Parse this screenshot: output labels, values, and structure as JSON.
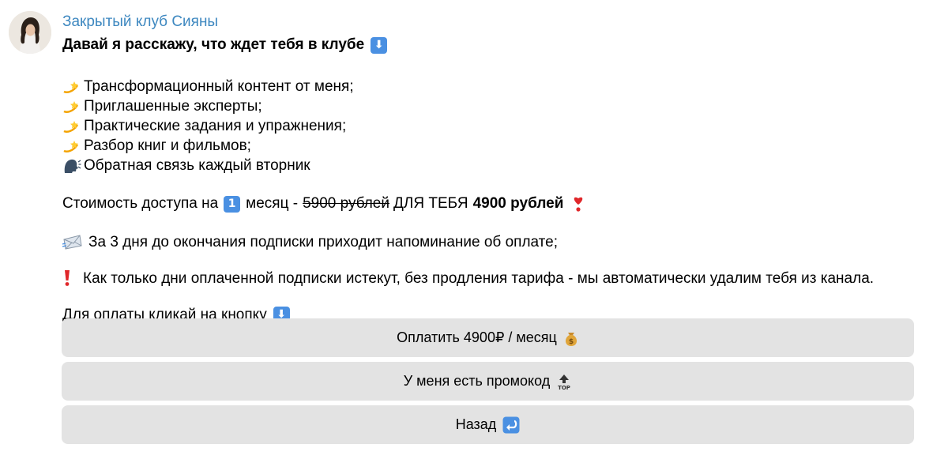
{
  "channel": {
    "name": "Закрытый клуб Сияны"
  },
  "message": {
    "headline": "Давай я расскажу, что ждет тебя в клубе",
    "features": [
      "Трансформационный контент от меня;",
      "Приглашенные эксперты;",
      "Практические задания и упражнения;",
      "Разбор книг и фильмов;",
      "Обратная связь каждый вторник"
    ],
    "price": {
      "prefix": "Стоимость доступа на",
      "months_badge": "1",
      "mid": "месяц -",
      "old_price": "5900 рублей",
      "for_you": "ДЛЯ ТЕБЯ",
      "new_price": "4900 рублей"
    },
    "reminder": "За 3 дня до окончания подписки приходит напоминание об оплате;",
    "warning": "Как только дни оплаченной подписки истекут, без продления тарифа - мы автоматически удалим тебя из канала.",
    "pay_prompt": "Для оплаты кликай на кнопку"
  },
  "buttons": {
    "pay": "Оплатить 4900₽ / месяц",
    "promo": "У меня есть промокод",
    "back": "Назад"
  },
  "icons": {
    "feature_bullet": "dizzy-icon",
    "feedback": "speaking-head-icon",
    "reminder": "incoming-envelope-icon",
    "warning": "exclamation-icon",
    "pay": "money-bag-icon",
    "promo": "top-arrow-icon",
    "back": "return-arrow-icon"
  },
  "colors": {
    "sender": "#3e88c0",
    "button_bg": "#e3e3e3",
    "badge": "#4a90e2",
    "warning": "#e0272a"
  }
}
